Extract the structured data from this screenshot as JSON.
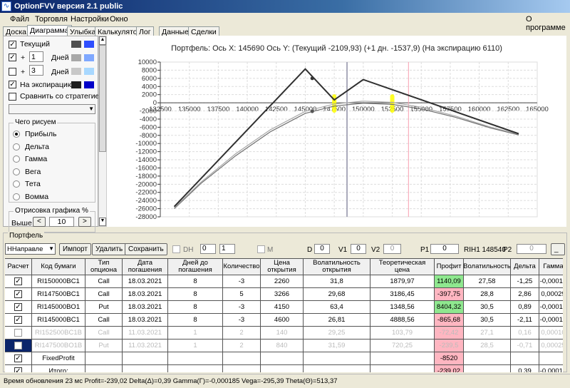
{
  "window": {
    "title": "OptionFVV версия 2.1 public",
    "icon": "app-icon"
  },
  "menu": [
    "Файл",
    "Торговля",
    "Настройки",
    "Окно"
  ],
  "menu_right": "О программе",
  "tabs": [
    "Доска",
    "Диаграмма",
    "Улыбка",
    "Калькулятор",
    "Лог",
    "Данные",
    "Сделки"
  ],
  "active_tab": "Диаграмма",
  "left": {
    "current_label": "Текущий",
    "current_checked": true,
    "current_colors": [
      "#505050",
      "#2f4fff"
    ],
    "plus1_prefix": "+",
    "plus1_value": "1",
    "plus1_unit": "Дней",
    "plus1_checked": true,
    "plus1_colors": [
      "#a8a8a8",
      "#7fa8ff"
    ],
    "plus3_prefix": "+",
    "plus3_value": "3",
    "plus3_unit": "Дней",
    "plus3_checked": false,
    "plus3_colors": [
      "#c8c8c8",
      "#a8d8ff"
    ],
    "exp_label": "На экспирацию",
    "exp_checked": true,
    "exp_colors": [
      "#202020",
      "#0000c8"
    ],
    "compare_label": "Сравнить со стратегией",
    "compare_checked": false,
    "what_title": "Чего рисуем",
    "what_options": [
      "Прибыль",
      "Дельта",
      "Гамма",
      "Вега",
      "Тета",
      "Вомма"
    ],
    "what_selected": "Прибыль",
    "draw_title": "Отрисовка графика %",
    "above_label": "Выше",
    "above_value": "10",
    "prev": "<",
    "next": ">"
  },
  "chart_header": "Портфель: Ось X:  145690  Ось Y:   (Текущий -2109,93)   (+1 дн. -1537,9)   (На экспирацию 6110)",
  "chart_data": {
    "type": "line",
    "xlim": [
      132500,
      165000
    ],
    "ylim": [
      -28000,
      10000
    ],
    "x_ticks": [
      132500,
      135000,
      137500,
      140000,
      142500,
      145000,
      147500,
      150000,
      152500,
      155000,
      157500,
      160000,
      162500,
      165000
    ],
    "y_ticks": [
      10000,
      8000,
      6000,
      4000,
      2000,
      0,
      -2000,
      -4000,
      -6000,
      -8000,
      -10000,
      -12000,
      -14000,
      -16000,
      -18000,
      -20000,
      -22000,
      -24000,
      -26000,
      -28000
    ],
    "grid": true,
    "markers": {
      "cursor_x": 148600,
      "pink_line_x": 153900,
      "highlighted_strikes": [
        147500,
        152500
      ]
    },
    "series": [
      {
        "key": "expiration",
        "color": "#303030",
        "x": [
          133700,
          145000,
          147500,
          150000,
          163400
        ],
        "y": [
          -25500,
          8300,
          700,
          5700,
          -7600
        ]
      },
      {
        "key": "plus1",
        "color": "#a8a8a8",
        "x": [
          133700,
          136000,
          139000,
          142000,
          145000,
          147500,
          150000,
          152500,
          155000,
          158000,
          161000,
          163400
        ],
        "y": [
          -25800,
          -19500,
          -12500,
          -6600,
          -2100,
          -300,
          400,
          100,
          -1100,
          -3300,
          -6000,
          -7700
        ]
      },
      {
        "key": "current",
        "color": "#707070",
        "x": [
          133700,
          136000,
          139000,
          142000,
          145000,
          147500,
          150000,
          152500,
          155000,
          158000,
          161000,
          163400
        ],
        "y": [
          -26000,
          -19800,
          -13000,
          -7100,
          -2600,
          -800,
          -100,
          -400,
          -1500,
          -3600,
          -6200,
          -7900
        ]
      }
    ]
  },
  "portfolio": {
    "title": "Портфель",
    "direction_value": "ННаправле",
    "import": "Импорт",
    "delete": "Удалить",
    "save": "Сохранить",
    "dh_label": "DH",
    "spin1": "0",
    "spin2": "1",
    "m_label": "M",
    "d_label": "D",
    "d_value": "0",
    "v1_label": "V1",
    "v1_value": "0",
    "v2_label": "V2",
    "v2_value": "0",
    "p1_label": "P1",
    "p1_value": "0",
    "rih_label": "RIH1 148540",
    "p2_label": "P2",
    "p2_value": "0",
    "more": "_"
  },
  "table": {
    "headers": [
      "Расчет",
      "Код бумаги",
      "Тип опциона",
      "Дата погашения",
      "Дней до погашения",
      "Количество",
      "Цена открытия",
      "Волатильность открытия",
      "Теоретическая цена",
      "Профит",
      "Волатильность",
      "Дельта",
      "Гамма"
    ],
    "rows": [
      {
        "checked": true,
        "dim": false,
        "sel": false,
        "cells": [
          "RI150000BC1",
          "Call",
          "18.03.2021",
          "8",
          "-3",
          "2260",
          "31,8",
          "1879,97",
          "1140,09",
          "27,58",
          "-1,25",
          "-0,00018"
        ],
        "profit": "green"
      },
      {
        "checked": true,
        "dim": false,
        "sel": false,
        "cells": [
          "RI147500BC1",
          "Call",
          "18.03.2021",
          "8",
          "5",
          "3266",
          "29,68",
          "3186,45",
          "-397,75",
          "28,8",
          "2,86",
          "0,00029"
        ],
        "profit": "red"
      },
      {
        "checked": true,
        "dim": false,
        "sel": false,
        "cells": [
          "RI145000BO1",
          "Put",
          "18.03.2021",
          "8",
          "-3",
          "4150",
          "63,4",
          "1348,56",
          "8404,32",
          "30,5",
          "0,89",
          "-0,00014"
        ],
        "profit": "green"
      },
      {
        "checked": true,
        "dim": false,
        "sel": false,
        "cells": [
          "RI145000BC1",
          "Call",
          "18.03.2021",
          "8",
          "-3",
          "4600",
          "26,81",
          "4888,56",
          "-865,68",
          "30,5",
          "-2,11",
          "-0,00014"
        ],
        "profit": "red"
      },
      {
        "checked": false,
        "dim": true,
        "sel": false,
        "cells": [
          "RI152500BC1B",
          "Call",
          "11.03.2021",
          "1",
          "2",
          "140",
          "29,25",
          "103,79",
          "-72,42",
          "27,1",
          "0,16",
          "0,00010"
        ],
        "profit": "red"
      },
      {
        "checked": false,
        "dim": true,
        "sel": true,
        "cells": [
          "RI147500BO1B",
          "Put",
          "11.03.2021",
          "1",
          "2",
          "840",
          "31,59",
          "720,25",
          "-239,5",
          "28,5",
          "-0,71",
          "0,00025"
        ],
        "profit": "red"
      },
      {
        "checked": true,
        "dim": false,
        "sel": false,
        "cells": [
          "FixedProfit",
          "",
          "",
          "",
          "",
          "",
          "",
          "",
          "-8520",
          "",
          "",
          ""
        ],
        "profit": "red"
      },
      {
        "checked": true,
        "dim": false,
        "sel": false,
        "cells": [
          "Итого:",
          "",
          "",
          "",
          "",
          "",
          "",
          "",
          "-239,02",
          "",
          "0,39",
          "-0,00018"
        ],
        "profit": "red"
      }
    ]
  },
  "status": "Время обновления 23 мс  Profit=-239,02 Delta(Δ)=0,39 Gamma(Γ)=-0,000185 Vega=-295,39 Theta(Θ)=513,37"
}
